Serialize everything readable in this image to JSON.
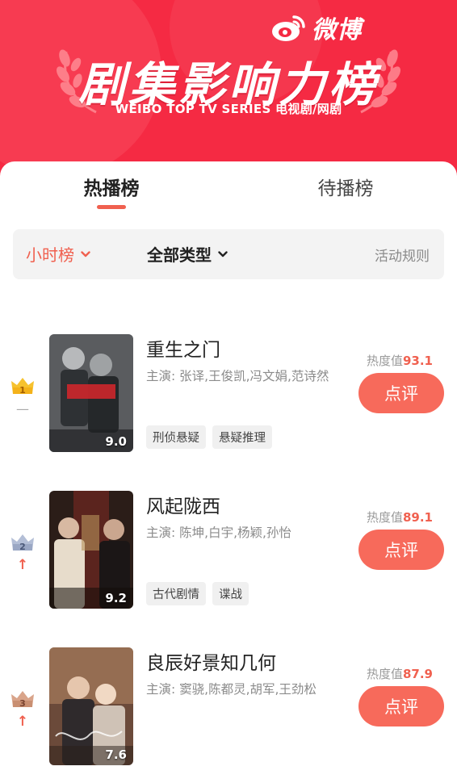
{
  "header": {
    "brand": "微博",
    "title": "剧集影响力榜",
    "subtitle": "WEIBO TOP TV SERIES 电视剧/网剧"
  },
  "tabs": [
    {
      "label": "热播榜",
      "active": true
    },
    {
      "label": "待播榜",
      "active": false
    }
  ],
  "filters": {
    "time": "小时榜",
    "type": "全部类型",
    "rules": "活动规则"
  },
  "colors": {
    "banner": "#f52a43",
    "accent": "#f0604f",
    "button": "#f76a5b"
  },
  "list": [
    {
      "rank": "1",
      "trend": "—",
      "trend_icon": "flat-dash-icon",
      "title": "重生之门",
      "cast": "主演: 张译,王俊凯,冯文娟,范诗然",
      "tags": [
        "刑侦悬疑",
        "悬疑推理"
      ],
      "score": "9.0",
      "heat_label": "热度值",
      "heat_value": "93.1",
      "button": "点评"
    },
    {
      "rank": "2",
      "trend": "↑",
      "trend_icon": "arrow-up-icon",
      "title": "风起陇西",
      "cast": "主演: 陈坤,白宇,杨颖,孙怡",
      "tags": [
        "古代剧情",
        "谍战"
      ],
      "score": "9.2",
      "heat_label": "热度值",
      "heat_value": "89.1",
      "button": "点评"
    },
    {
      "rank": "3",
      "trend": "↑",
      "trend_icon": "arrow-up-icon",
      "title": "良辰好景知几何",
      "cast": "主演: 窦骁,陈都灵,胡军,王劲松",
      "tags": [],
      "score": "7.6",
      "heat_label": "热度值",
      "heat_value": "87.9",
      "button": "点评"
    }
  ]
}
